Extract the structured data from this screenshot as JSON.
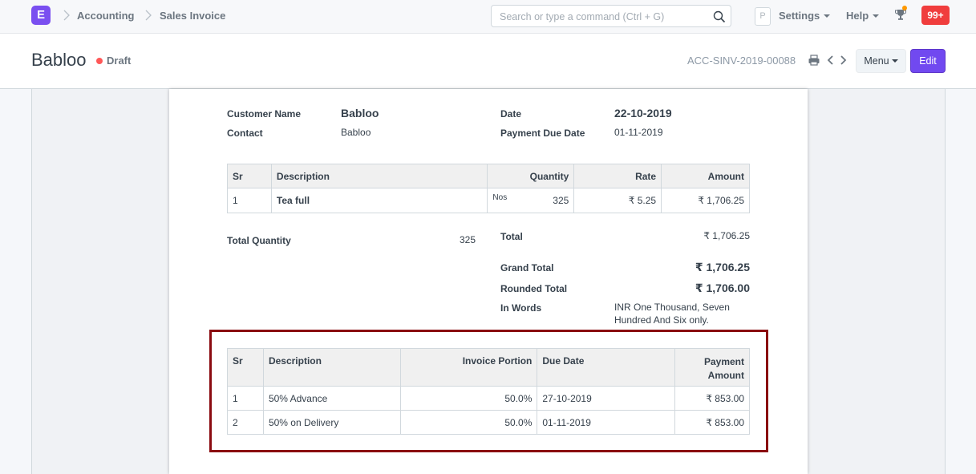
{
  "navbar": {
    "logo_letter": "E",
    "breadcrumbs": [
      "Accounting",
      "Sales Invoice"
    ],
    "search_placeholder": "Search or type a command (Ctrl + G)",
    "p_label": "P",
    "settings_label": "Settings",
    "help_label": "Help",
    "notifications_count": "99+"
  },
  "page_head": {
    "title": "Babloo",
    "status": "Draft",
    "doc_id": "ACC-SINV-2019-00088",
    "menu_label": "Menu",
    "edit_label": "Edit"
  },
  "invoice": {
    "customer_name_label": "Customer Name",
    "customer_name": "Babloo",
    "contact_label": "Contact",
    "contact": "Babloo",
    "date_label": "Date",
    "date": "22-10-2019",
    "due_date_label": "Payment Due Date",
    "due_date": "01-11-2019",
    "items_headers": [
      "Sr",
      "Description",
      "Quantity",
      "Rate",
      "Amount"
    ],
    "items": [
      {
        "sr": "1",
        "description": "Tea full",
        "uom": "Nos",
        "qty": "325",
        "rate": "₹ 5.25",
        "amount": "₹ 1,706.25"
      }
    ],
    "total_qty_label": "Total Quantity",
    "total_qty": "325",
    "total_label": "Total",
    "total": "₹ 1,706.25",
    "grand_total_label": "Grand Total",
    "grand_total": "₹ 1,706.25",
    "rounded_total_label": "Rounded Total",
    "rounded_total": "₹ 1,706.00",
    "in_words_label": "In Words",
    "in_words_line1": "INR One Thousand, Seven",
    "in_words_line2": "Hundred And Six only.",
    "schedule_headers": [
      "Sr",
      "Description",
      "Invoice Portion",
      "Due Date",
      "Payment",
      "Amount"
    ],
    "schedule": [
      {
        "sr": "1",
        "description": "50% Advance",
        "portion": "50.0%",
        "due_date": "27-10-2019",
        "amount": "₹ 853.00"
      },
      {
        "sr": "2",
        "description": "50% on Delivery",
        "portion": "50.0%",
        "due_date": "01-11-2019",
        "amount": "₹ 853.00"
      }
    ]
  },
  "colors": {
    "accent": "#7149f0",
    "draft_dot": "#ff5858",
    "badge": "#f03d3d",
    "highlight": "#8a0a10"
  }
}
